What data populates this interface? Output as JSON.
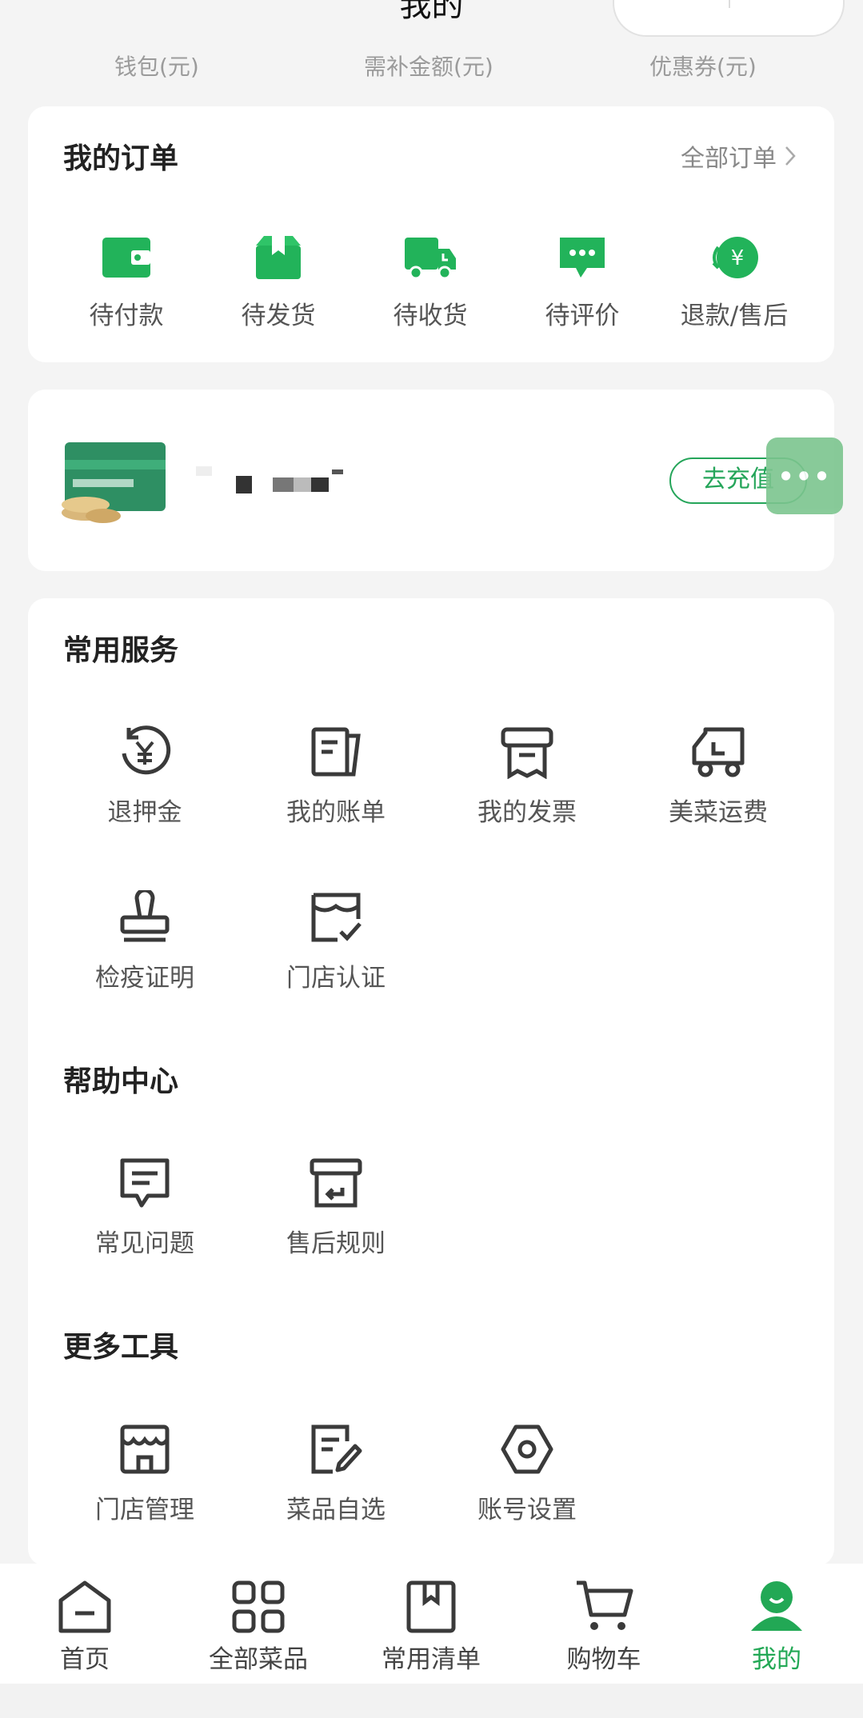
{
  "header": {
    "title": "我的"
  },
  "stats": [
    {
      "label": "钱包(元)"
    },
    {
      "label": "需补金额(元)"
    },
    {
      "label": "优惠券(元)"
    }
  ],
  "orders": {
    "title": "我的订单",
    "all_link": "全部订单",
    "items": [
      {
        "label": "待付款",
        "icon": "wallet-icon"
      },
      {
        "label": "待发货",
        "icon": "package-icon"
      },
      {
        "label": "待收货",
        "icon": "truck-icon"
      },
      {
        "label": "待评价",
        "icon": "chat-bubble-icon"
      },
      {
        "label": "退款/售后",
        "icon": "refund-icon"
      }
    ]
  },
  "card_promo": {
    "button": "去充值",
    "float_button": "•••"
  },
  "services": {
    "title": "常用服务",
    "items": [
      {
        "label": "退押金",
        "icon": "deposit-refund-icon"
      },
      {
        "label": "我的账单",
        "icon": "bill-icon"
      },
      {
        "label": "我的发票",
        "icon": "invoice-icon"
      },
      {
        "label": "美菜运费",
        "icon": "delivery-truck-icon"
      },
      {
        "label": "检疫证明",
        "icon": "stamp-icon"
      },
      {
        "label": "门店认证",
        "icon": "store-verified-icon"
      }
    ]
  },
  "help": {
    "title": "帮助中心",
    "items": [
      {
        "label": "常见问题",
        "icon": "faq-icon"
      },
      {
        "label": "售后规则",
        "icon": "return-box-icon"
      }
    ]
  },
  "tools": {
    "title": "更多工具",
    "items": [
      {
        "label": "门店管理",
        "icon": "store-icon"
      },
      {
        "label": "菜品自选",
        "icon": "edit-list-icon"
      },
      {
        "label": "账号设置",
        "icon": "hex-settings-icon"
      }
    ]
  },
  "tabbar": {
    "items": [
      {
        "label": "首页",
        "icon": "home-icon"
      },
      {
        "label": "全部菜品",
        "icon": "grid-icon"
      },
      {
        "label": "常用清单",
        "icon": "bookmark-list-icon"
      },
      {
        "label": "购物车",
        "icon": "cart-icon"
      },
      {
        "label": "我的",
        "icon": "profile-icon",
        "active": true
      }
    ]
  },
  "colors": {
    "accent": "#22a855",
    "icon_gray": "#3a3a3a",
    "background": "#f4f4f4"
  }
}
